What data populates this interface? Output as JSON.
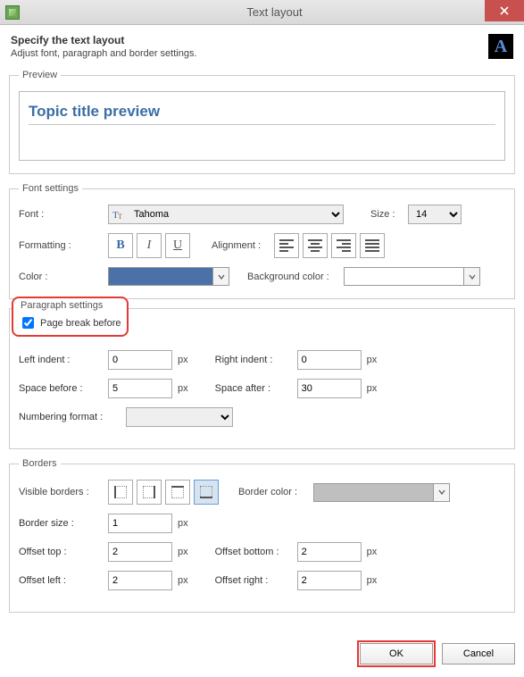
{
  "window": {
    "title": "Text layout",
    "close_tooltip": "Close"
  },
  "header": {
    "title": "Specify the text layout",
    "subtitle": "Adjust font, paragraph and border settings."
  },
  "preview": {
    "legend": "Preview",
    "text": "Topic title preview"
  },
  "font_settings": {
    "legend": "Font settings",
    "font_label": "Font :",
    "font_value": "Tahoma",
    "size_label": "Size :",
    "size_value": "14",
    "formatting_label": "Formatting :",
    "bold_glyph": "B",
    "italic_glyph": "I",
    "underline_glyph": "U",
    "alignment_label": "Alignment :",
    "color_label": "Color :",
    "color_value": "#4a72a8",
    "bg_label": "Background color :",
    "bg_value": "#ffffff"
  },
  "paragraph": {
    "legend": "Paragraph settings",
    "page_break_label": "Page break before",
    "page_break_checked": true,
    "left_indent_label": "Left indent :",
    "left_indent_value": "0",
    "right_indent_label": "Right indent :",
    "right_indent_value": "0",
    "space_before_label": "Space before :",
    "space_before_value": "5",
    "space_after_label": "Space after :",
    "space_after_value": "30",
    "numbering_label": "Numbering format :",
    "numbering_value": "",
    "unit": "px"
  },
  "borders": {
    "legend": "Borders",
    "visible_label": "Visible borders :",
    "border_color_label": "Border color :",
    "border_color_value": "#bfbfbf",
    "border_size_label": "Border size :",
    "border_size_value": "1",
    "offset_top_label": "Offset top :",
    "offset_top_value": "2",
    "offset_bottom_label": "Offset bottom :",
    "offset_bottom_value": "2",
    "offset_left_label": "Offset left :",
    "offset_left_value": "2",
    "offset_right_label": "Offset right :",
    "offset_right_value": "2",
    "unit": "px"
  },
  "footer": {
    "ok": "OK",
    "cancel": "Cancel"
  }
}
